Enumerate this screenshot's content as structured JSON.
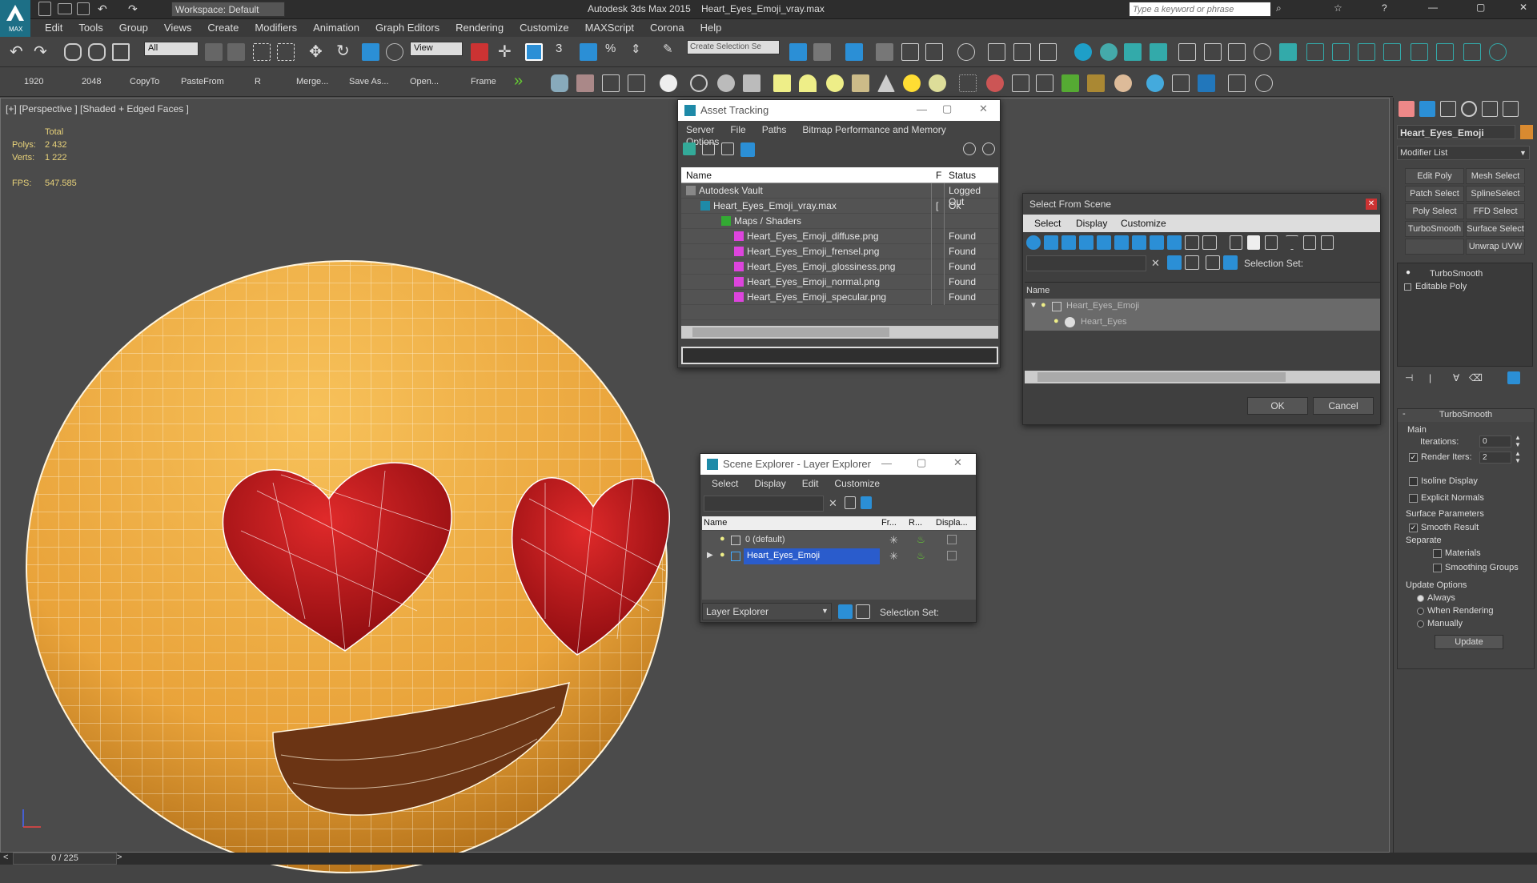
{
  "titlebar": {
    "workspace": "Workspace: Default",
    "app_title": "Autodesk 3ds Max  2015",
    "file_title": "Heart_Eyes_Emoji_vray.max",
    "search_placeholder": "Type a keyword or phrase",
    "logo": "MAX"
  },
  "menubar": {
    "items": [
      "Edit",
      "Tools",
      "Group",
      "Views",
      "Create",
      "Modifiers",
      "Animation",
      "Graph Editors",
      "Rendering",
      "Customize",
      "MAXScript",
      "Corona",
      "Help"
    ]
  },
  "toolbar1": {
    "selection_filter": "All",
    "ref_coord": "View",
    "named_selection": "Create Selection Se"
  },
  "toolbar2": {
    "labels": [
      "1920",
      "2048",
      "CopyTo",
      "PasteFrom",
      "R",
      "Merge...",
      "Save As...",
      "Open...",
      "Frame"
    ]
  },
  "viewport": {
    "label": "[+] [Perspective ] [Shaded + Edged Faces ]",
    "stats": {
      "total_label": "Total",
      "polys_label": "Polys:",
      "polys_value": "2 432",
      "verts_label": "Verts:",
      "verts_value": "1 222",
      "fps_label": "FPS:",
      "fps_value": "547.585"
    },
    "colors": {
      "face": "#f0a93a",
      "wire": "#fff4dc",
      "heart": "#c4161c",
      "mouth": "#6b3414"
    }
  },
  "asset_tracking": {
    "title": "Asset Tracking",
    "menu": [
      "Server",
      "File",
      "Paths",
      "Bitmap Performance and Memory",
      "Options"
    ],
    "columns": [
      "Name",
      "F",
      "Status"
    ],
    "rows": [
      {
        "name": "Autodesk Vault",
        "f": "",
        "status": "Logged Out"
      },
      {
        "name": "Heart_Eyes_Emoji_vray.max",
        "f": "[",
        "status": "Ok"
      },
      {
        "name": "Maps / Shaders",
        "f": "",
        "status": ""
      },
      {
        "name": "Heart_Eyes_Emoji_diffuse.png",
        "f": "",
        "status": "Found"
      },
      {
        "name": "Heart_Eyes_Emoji_frensel.png",
        "f": "",
        "status": "Found"
      },
      {
        "name": "Heart_Eyes_Emoji_glossiness.png",
        "f": "",
        "status": "Found"
      },
      {
        "name": "Heart_Eyes_Emoji_normal.png",
        "f": "",
        "status": "Found"
      },
      {
        "name": "Heart_Eyes_Emoji_specular.png",
        "f": "",
        "status": "Found"
      }
    ]
  },
  "select_from_scene": {
    "title": "Select From Scene",
    "tabs": [
      "Select",
      "Display",
      "Customize"
    ],
    "selection_set_label": "Selection Set:",
    "column_name": "Name",
    "items": [
      "Heart_Eyes_Emoji",
      "Heart_Eyes"
    ],
    "ok": "OK",
    "cancel": "Cancel"
  },
  "scene_explorer": {
    "title": "Scene Explorer - Layer Explorer",
    "menu": [
      "Select",
      "Display",
      "Edit",
      "Customize"
    ],
    "columns": [
      "Name",
      "Fr...",
      "R...",
      "Displa..."
    ],
    "layers": [
      "0 (default)",
      "Heart_Eyes_Emoji"
    ],
    "footer_dropdown": "Layer Explorer",
    "footer_selection_set": "Selection Set:"
  },
  "command_panel": {
    "object_name": "Heart_Eyes_Emoji",
    "modifier_list": "Modifier List",
    "mod_buttons": [
      "Edit Poly",
      "Mesh Select",
      "Patch Select",
      "SplineSelect",
      "Poly Select",
      "FFD Select",
      "TurboSmooth",
      "Surface Select",
      "",
      "Unwrap UVW"
    ],
    "stack": [
      "TurboSmooth",
      "Editable Poly"
    ],
    "rollout_title": "TurboSmooth",
    "main_label": "Main",
    "iterations_label": "Iterations:",
    "iterations_value": "0",
    "render_iters_label": "Render Iters:",
    "render_iters_value": "2",
    "isoline_label": "Isoline Display",
    "explicit_label": "Explicit Normals",
    "surface_params_label": "Surface Parameters",
    "smooth_result_label": "Smooth Result",
    "separate_label": "Separate",
    "materials_label": "Materials",
    "smoothing_groups_label": "Smoothing Groups",
    "update_options_label": "Update Options",
    "always_label": "Always",
    "when_rendering_label": "When Rendering",
    "manually_label": "Manually",
    "update_button": "Update"
  },
  "timeline": {
    "frame": "0 / 225"
  }
}
